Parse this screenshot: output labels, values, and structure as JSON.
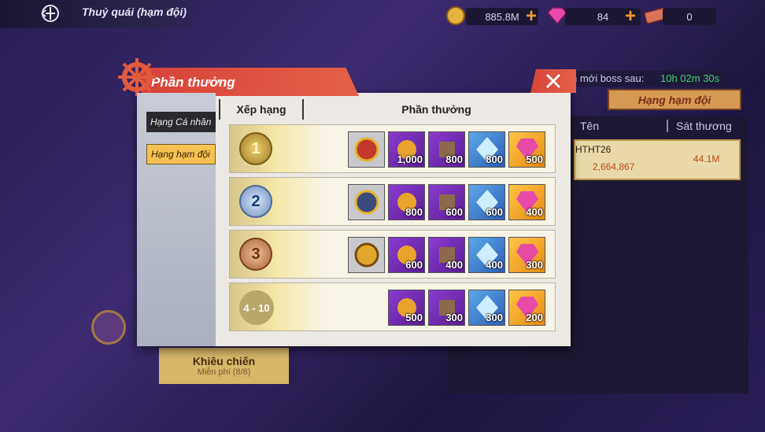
{
  "topbar": {
    "title": "Thuỷ quái (hạm đội)",
    "gold": "885.8M",
    "gems": "84",
    "tickets": "0"
  },
  "background": {
    "boss_prefix": "n mới boss sau:",
    "boss_time": "10h 02m 30s",
    "team_rank_button": "Hạng hạm đội",
    "col_name": "Tên",
    "col_damage": "Sát thương",
    "row_name": "HTHT26",
    "row_power": "2,664,867",
    "row_damage": "44.1M",
    "challenge_label": "Khiêu chiến",
    "challenge_sub": "Miễn phí (8/8)"
  },
  "modal": {
    "title": "Phần thưởng",
    "tabs": [
      "Hạng Cá nhân",
      "Hạng hạm đội"
    ],
    "col_rank": "Xếp hạng",
    "col_reward": "Phần thưởng",
    "rows": [
      {
        "rank": "1",
        "items": [
          "1,000",
          "800",
          "800",
          "500"
        ]
      },
      {
        "rank": "2",
        "items": [
          "800",
          "600",
          "600",
          "400"
        ]
      },
      {
        "rank": "3",
        "items": [
          "600",
          "400",
          "400",
          "300"
        ]
      },
      {
        "rank": "4 - 10",
        "items": [
          "500",
          "300",
          "300",
          "200"
        ]
      }
    ]
  },
  "colors": {
    "accent_red": "#d8433a",
    "active_tab": "#f6c252",
    "timer_green": "#3ed06b"
  }
}
